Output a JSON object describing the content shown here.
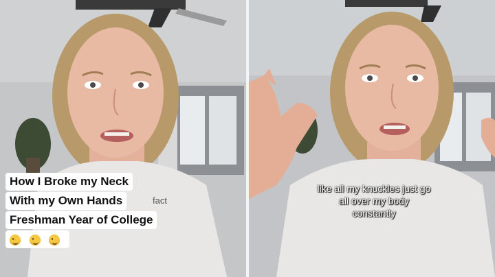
{
  "left_panel": {
    "caption_lines": [
      "How I Broke my Neck",
      "With my Own Hands",
      "Freshman Year of College"
    ],
    "emoji_icon": "upside-down-face-emoji",
    "emoji_count": 3,
    "background_word": "fact"
  },
  "right_panel": {
    "subtitle_lines": [
      "like all my knuckles just go",
      "all over my body",
      "constantly"
    ]
  },
  "colors": {
    "shirt": "#e9e7e6",
    "hair": "#b89a6a",
    "skin": "#e8b9a3",
    "wall": "#bfc1c4"
  }
}
